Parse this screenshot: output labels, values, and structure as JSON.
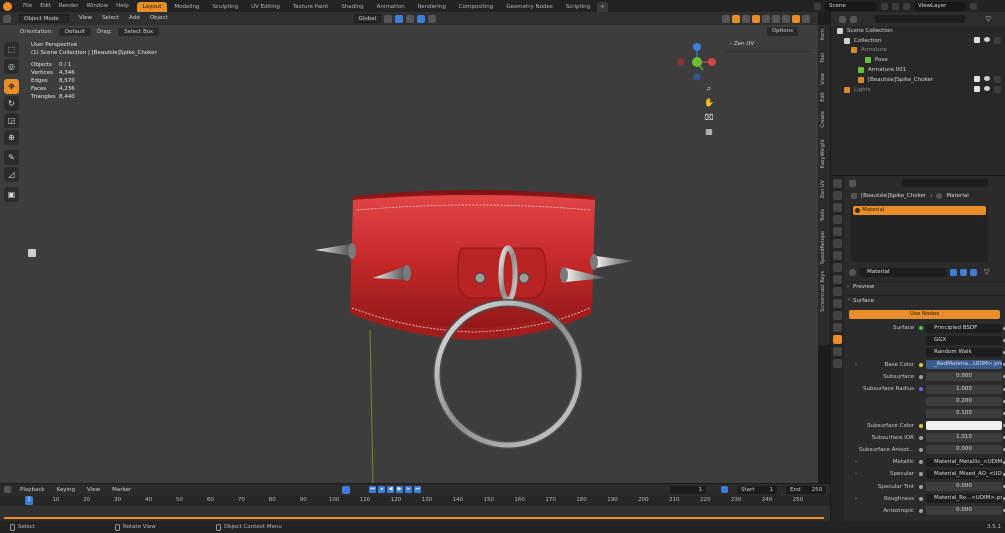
{
  "topbar": {
    "menus": [
      "File",
      "Edit",
      "Render",
      "Window",
      "Help"
    ],
    "workspaces": [
      {
        "label": "Layout",
        "active": true
      },
      {
        "label": "Modeling"
      },
      {
        "label": "Sculpting"
      },
      {
        "label": "UV Editing"
      },
      {
        "label": "Texture Paint"
      },
      {
        "label": "Shading"
      },
      {
        "label": "Animation"
      },
      {
        "label": "Rendering"
      },
      {
        "label": "Compositing"
      },
      {
        "label": "Geometry Nodes"
      },
      {
        "label": "Scripting"
      }
    ],
    "add_tab": "+",
    "scene": "Scene",
    "view_layer": "ViewLayer"
  },
  "viewport": {
    "mode": "Object Mode",
    "menus": [
      "View",
      "Select",
      "Add",
      "Object"
    ],
    "transform": "Global",
    "orientation_label": "Orientation:",
    "orientation_value": "Default",
    "drag_label": "Drag:",
    "drag_value": "Select Box",
    "options": "Options",
    "perspective": "User Perspective",
    "collection_path": "(1) Scene Collection | [Beautsle]Spike_Choker",
    "stats": [
      {
        "k": "Objects",
        "v": "0 / 1"
      },
      {
        "k": "Vertices",
        "v": "4,346"
      },
      {
        "k": "Edges",
        "v": "8,570"
      },
      {
        "k": "Faces",
        "v": "4,236"
      },
      {
        "k": "Triangles",
        "v": "8,440"
      }
    ],
    "sidebar_panel": "Zen UV",
    "vtabs": [
      "Item",
      "Tool",
      "View",
      "Edit",
      "Create",
      "EasyWeight",
      "Zen UV",
      "Tools",
      "SpeedRetopo",
      "Screencast Keys"
    ]
  },
  "timeline": {
    "menus": [
      "Playback",
      "Keying",
      "View",
      "Marker"
    ],
    "current_frame": "1",
    "start_label": "Start",
    "start": "1",
    "end_label": "End",
    "end": "250",
    "ticks": [
      "10",
      "20",
      "30",
      "40",
      "50",
      "60",
      "70",
      "80",
      "90",
      "100",
      "110",
      "120",
      "130",
      "140",
      "150",
      "160",
      "170",
      "180",
      "190",
      "200",
      "210",
      "220",
      "230",
      "240",
      "250"
    ],
    "playhead": "1"
  },
  "statusbar": {
    "select": "Select",
    "rotate": "Rotate View",
    "context": "Object Context Menu",
    "version": "3.5.1"
  },
  "outliner": {
    "rows": [
      {
        "label": "Scene Collection",
        "indent": 0
      },
      {
        "label": "Collection",
        "indent": 1
      },
      {
        "label": "Armature",
        "indent": 2,
        "dim": true
      },
      {
        "label": "Pose",
        "indent": 4
      },
      {
        "label": "Armature.001",
        "indent": 3
      },
      {
        "label": "[Beautsle]Spike_Choker",
        "indent": 3
      },
      {
        "label": "Lights",
        "indent": 1,
        "dim": true
      }
    ]
  },
  "properties": {
    "breadcrumb_object": "[Beautsle]Spike_Choker",
    "breadcrumb_section": "Material",
    "slot": "Material",
    "material_name": "Material",
    "preview": "Preview",
    "surface_panel": "Surface",
    "use_nodes": "Use Nodes",
    "rows": [
      {
        "label": "Surface",
        "value": "Principled BSDF",
        "dot": "#4ec25b"
      },
      {
        "label": "",
        "value": "GGX"
      },
      {
        "label": "",
        "value": "Random Walk"
      },
      {
        "label": "Base Color",
        "value": "_RedMateria...UDIM>.png",
        "dot": "#e0c63c",
        "arrow": true,
        "highlight": true
      },
      {
        "label": "Subsurface",
        "value": "0.000",
        "num": true,
        "dot": "#a0a0a0"
      },
      {
        "label": "Subsurface Radius",
        "value": "1.000",
        "num": true,
        "dot": "#6d6ad8"
      },
      {
        "label": "",
        "value": "0.200",
        "num": true
      },
      {
        "label": "",
        "value": "0.100",
        "num": true
      },
      {
        "label": "Subsurface Color",
        "value": "",
        "white": true,
        "dot": "#e0c63c"
      },
      {
        "label": "Subsurface IOR",
        "value": "1.010",
        "num": true,
        "dot": "#a0a0a0"
      },
      {
        "label": "Subsurface Anisot...",
        "value": "0.000",
        "num": true,
        "dot": "#a0a0a0"
      },
      {
        "label": "Metallic",
        "value": "Material_Metallic_<UDIM...",
        "dot": "#a0a0a0",
        "arrow": true
      },
      {
        "label": "Specular",
        "value": "Material_Mixed_AO_<UDI...",
        "dot": "#a0a0a0",
        "arrow": true
      },
      {
        "label": "Specular Tint",
        "value": "0.000",
        "num": true,
        "dot": "#a0a0a0"
      },
      {
        "label": "Roughness",
        "value": "Material_Ro...<UDIM>.png",
        "dot": "#a0a0a0",
        "arrow": true
      },
      {
        "label": "Anisotropic",
        "value": "0.000",
        "num": true,
        "dot": "#a0a0a0"
      }
    ]
  },
  "colors": {
    "accent": "#e88d27",
    "selection": "#3f7ed8",
    "collar": "#c92b2b"
  }
}
